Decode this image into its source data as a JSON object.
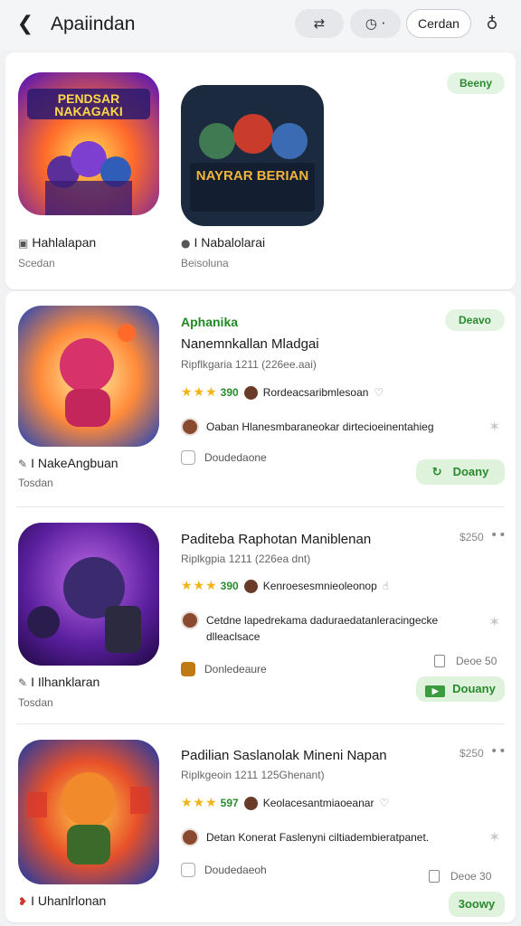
{
  "header": {
    "title": "Apaiindan",
    "back_icon": "chevron-left-icon",
    "share_icon": "share-icon",
    "clock_icon": "clock-icon",
    "order_label": "Cerdan",
    "bulb_icon": "lightbulb-icon"
  },
  "featured": {
    "chip": "Beeny",
    "apps": [
      {
        "icon_text": "PENDSAR NAKAGAKI",
        "name": "Hahlalapan",
        "sub": "Scedan"
      },
      {
        "icon_text": "NAYRAR BERIAN",
        "name": "I Nabalolarai",
        "sub": "Beisoluna"
      }
    ]
  },
  "list": [
    {
      "label": "Aphanika",
      "chip": "Deavo",
      "title": "Nanemnkallan Mladgai",
      "meta": "Ripflkgaria 1211 (226ee.aai)",
      "stars": "★★★",
      "rating": "390",
      "rating_text": "Rordeacsaribmlesoan",
      "review": "Oaban Hlanesmbaraneokar dirtecioeinentahieg",
      "developer": "Doudedaone",
      "action": "Doany",
      "left_name": "I NakeAngbuan",
      "left_sub": "Tosdan"
    },
    {
      "title": "Paditeba Raphotan Maniblenan",
      "meta": "Riplkgpia 1211 (226ea dnt)",
      "price": "$250",
      "stars": "★★★",
      "rating": "390",
      "rating_text": "Kenroesesmnieoleonop",
      "review": "Cetdne lapedrekama daduraedatanleracingecke dlleaclsace",
      "developer": "Donledeaure",
      "size": "Deoe 50",
      "action": "Douany",
      "left_name": "I Ilhanklaran",
      "left_sub": "Tosdan"
    },
    {
      "title": "Padilian Saslanolak Mineni Napan",
      "meta": "Riplkgeoin 1211 125Ghenant)",
      "price": "$250",
      "stars": "★★★",
      "rating": "597",
      "rating_text": "Keolacesantmiaoeanar",
      "review": "Detan Konerat Faslenyni ciltiadembieratpanet.",
      "developer": "Doudedaeoh",
      "size": "Deoe 30",
      "action": "3oowy",
      "left_name": "I Uhanlrlonan",
      "left_sub": ""
    }
  ],
  "colors": {
    "accent": "#2a8a2e",
    "star": "#f3b313",
    "chip_bg": "#e4f4e3"
  }
}
